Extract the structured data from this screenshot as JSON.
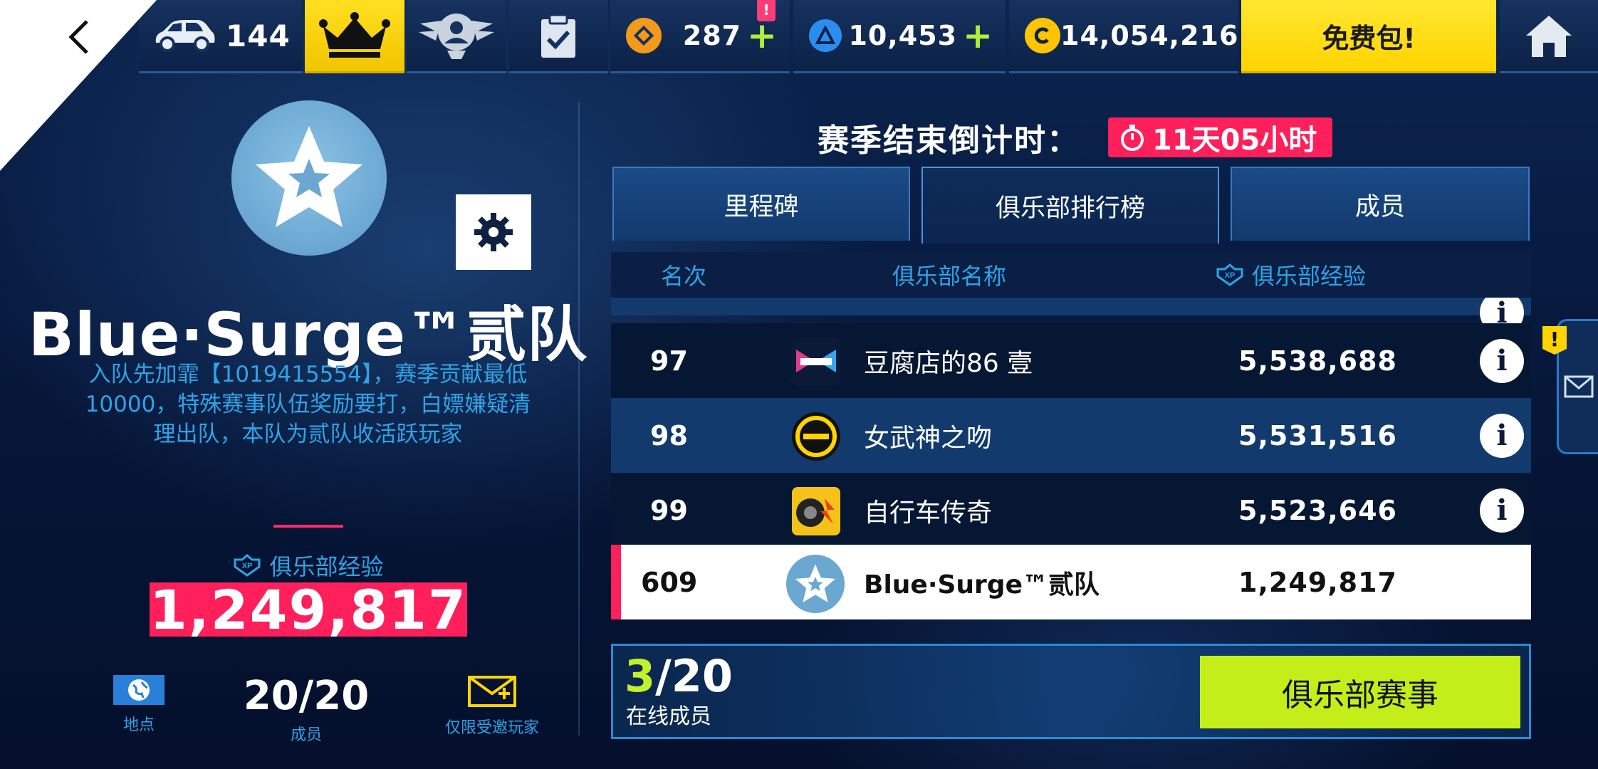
{
  "topbar": {
    "cars_count": "144",
    "currencies": [
      {
        "name": "tokens",
        "value": "287",
        "plus": "+",
        "color": "#f39a1c"
      },
      {
        "name": "blueprints",
        "value": "10,453",
        "plus": "+",
        "color": "#2a8ef0"
      },
      {
        "name": "credits",
        "value": "14,054,216",
        "plus": "+",
        "color": "#ffc400"
      }
    ],
    "alert_mark": "!",
    "free_pack_label": "免费包!"
  },
  "club": {
    "name": "Blue·Surge™贰队",
    "description": "入队先加霏【1019415554】，赛季贡献最低10000，特殊赛事队伍奖励要打，白嫖嫌疑清理出队，本队为贰队收活跃玩家",
    "xp_label": "俱乐部经验",
    "xp_value": "1,249,817",
    "stats": {
      "location_caption": "地点",
      "members_value": "20/20",
      "members_caption": "成员",
      "invite_caption": "仅限受邀玩家"
    }
  },
  "season": {
    "countdown_label": "赛季结束倒计时：",
    "time_left": "11天05小时"
  },
  "tabs": [
    "里程碑",
    "俱乐部排行榜",
    "成员"
  ],
  "leaderboard": {
    "headers": {
      "rank": "名次",
      "name": "俱乐部名称",
      "xp": "俱乐部经验"
    },
    "rows": [
      {
        "rank": "97",
        "name": "豆腐店的86 壹",
        "xp": "5,538,688"
      },
      {
        "rank": "98",
        "name": "女武神之吻",
        "xp": "5,531,516"
      },
      {
        "rank": "99",
        "name": "自行车传奇",
        "xp": "5,523,646"
      }
    ],
    "self_row": {
      "rank": "609",
      "name": "Blue·Surge™贰队",
      "xp": "1,249,817"
    }
  },
  "online": {
    "current": "3",
    "total": "/20",
    "label": "在线成员",
    "event_button": "俱乐部赛事"
  },
  "side": {
    "mail_alert": "!"
  },
  "colors": {
    "accent_pink": "#ff1f5a",
    "accent_yellow": "#ffd400",
    "accent_lime": "#c4ee1a",
    "text_blue": "#2ea3e6"
  },
  "icons": [
    "back-arrow-icon",
    "car-icon",
    "crown-icon",
    "badge-icon",
    "clipboard-check-icon",
    "token-icon",
    "blueprint-icon",
    "credits-icon",
    "home-icon",
    "star-emblem-icon",
    "gear-icon",
    "xp-icon",
    "stopwatch-icon",
    "globe-icon",
    "envelope-plus-icon",
    "info-icon",
    "mail-icon"
  ]
}
